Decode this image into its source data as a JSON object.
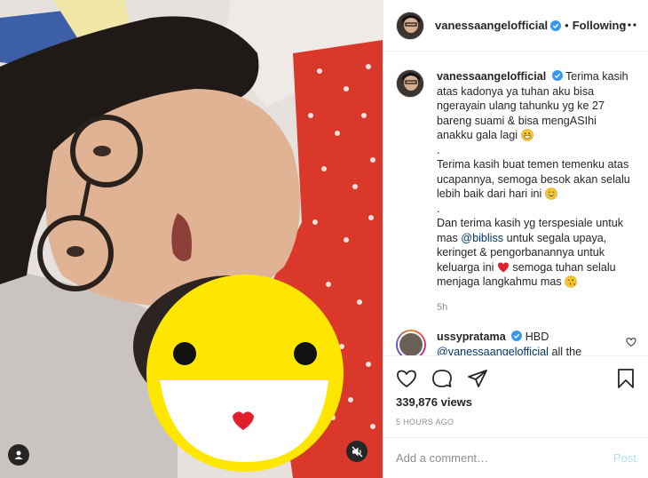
{
  "post": {
    "author": "vanessaangelofficial",
    "follow_state": "Following",
    "separator": "•",
    "caption_line1": "Terima kasih atas kadonya ya tuhan aku bisa ngerayain ulang tahunku yg ke 27 bareng suami & bisa mengASIhi anakku gala lagi",
    "caption_dot1": ".",
    "caption_line2": "Terima kasih buat temen temenku atas ucapannya, semoga besok akan selalu lebih baik dari hari ini",
    "caption_dot2": ".",
    "caption_line3a": "Dan terima kasih yg terspesiale untuk mas",
    "caption_mention": "@bibliss",
    "caption_line3b": "untuk segala upaya, keringet & pengorbanannya untuk keluarga ini",
    "caption_line3c": "semoga tuhan selalu menjaga langkahmu mas",
    "relative_time": "5h"
  },
  "comment": {
    "author": "ussypratama",
    "text": "HBD",
    "mention": "@vanessaangelofficial",
    "text_tail": "all the"
  },
  "engagement": {
    "views": "339,876 views",
    "posted": "5 HOURS AGO"
  },
  "add_comment": {
    "placeholder": "Add a comment…",
    "post_label": "Post"
  },
  "icons": {
    "more": "more-options-icon",
    "like": "heart-icon",
    "comment": "comment-icon",
    "share": "share-icon",
    "save": "bookmark-icon",
    "user_tag": "user-tag-icon",
    "mute": "muted-speaker-icon"
  },
  "colors": {
    "verified": "#3897f0",
    "link": "#00376b",
    "post_disabled": "#b2dffc",
    "secondary_text": "#8e8e8e",
    "smiley": "#ffe600"
  }
}
